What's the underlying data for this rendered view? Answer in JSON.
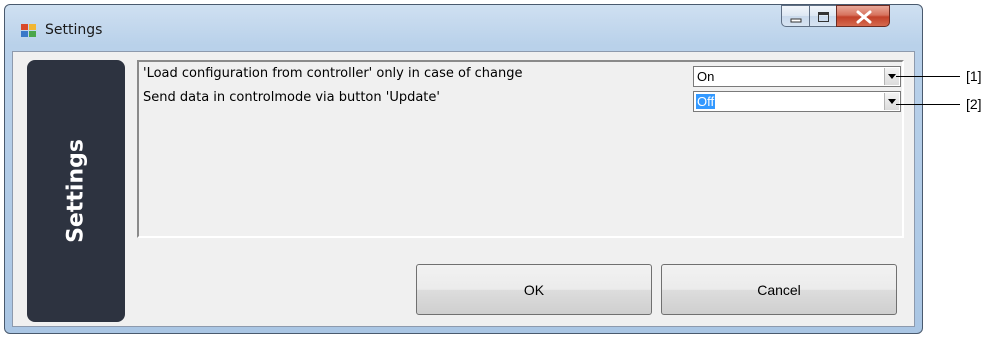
{
  "window": {
    "title": "Settings",
    "icons": {
      "app": "app-window-icon",
      "minimize": "minimize-icon",
      "maximize": "maximize-icon",
      "close": "close-icon"
    }
  },
  "side_panel": {
    "label": "Settings"
  },
  "settings": {
    "rows": [
      {
        "label": "'Load configuration from controller' only in case of change",
        "value": "On"
      },
      {
        "label": "Send data in controlmode via button 'Update'",
        "value": "Off"
      }
    ]
  },
  "buttons": {
    "ok": "OK",
    "cancel": "Cancel"
  },
  "callouts": [
    "[1]",
    "[2]"
  ],
  "colors": {
    "side_panel": "#2d3340",
    "selection": "#3399ff",
    "close_button": "#c2412a"
  }
}
